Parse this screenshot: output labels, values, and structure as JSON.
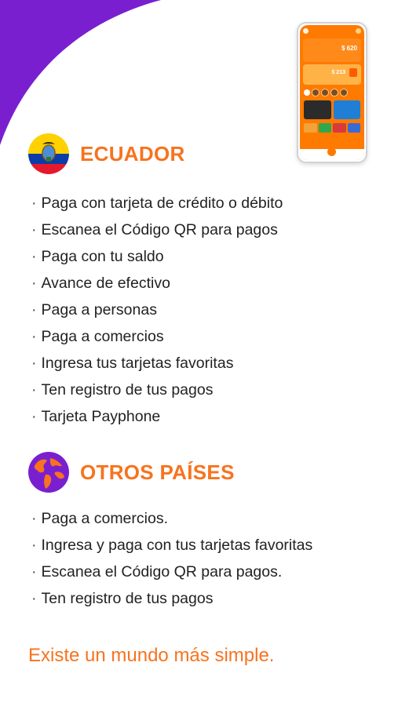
{
  "colors": {
    "accent_orange": "#f7731e",
    "brand_purple": "#7a1fd0",
    "text": "#222222"
  },
  "decor": {
    "corner_swoosh": "purple-corner-swoosh",
    "phone_mockup": "payphone-app-phone-mockup"
  },
  "phone": {
    "balance_amount": "$ 620",
    "wallet_amount": "$ 213"
  },
  "ecuador": {
    "icon": "ecuador-flag-icon",
    "title": "ECUADOR",
    "features": [
      "Paga con tarjeta de crédito o débito",
      "Escanea el Código QR para pagos",
      "Paga con tu saldo",
      "Avance de efectivo",
      "Paga a personas",
      "Paga a comercios",
      "Ingresa tus tarjetas favoritas",
      "Ten registro de tus pagos",
      "Tarjeta Payphone"
    ]
  },
  "otros": {
    "icon": "globe-icon",
    "title": "OTROS PAÍSES",
    "features": [
      "Paga a comercios.",
      "Ingresa y paga con tus tarjetas favoritas",
      "Escanea el Código QR para pagos.",
      "Ten registro de tus pagos"
    ]
  },
  "tagline": "Existe un mundo más simple."
}
